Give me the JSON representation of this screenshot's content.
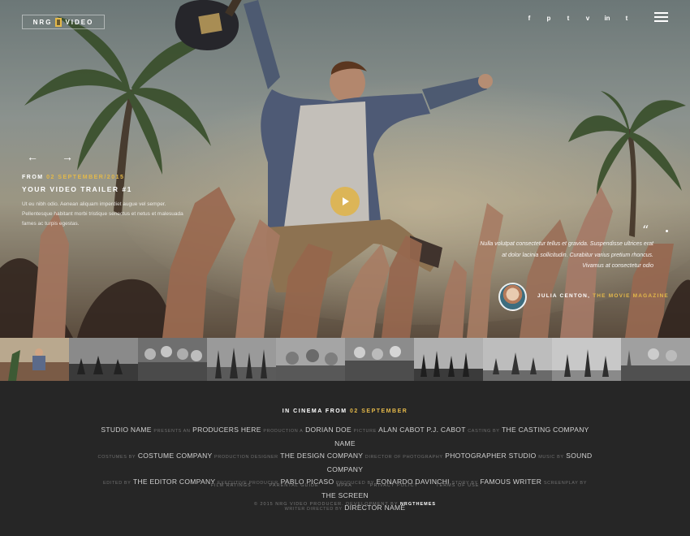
{
  "header": {
    "logo_left": "NRG",
    "logo_right": "VIDEO",
    "social": [
      "f",
      "p",
      "t",
      "v",
      "in",
      "t"
    ]
  },
  "slider": {
    "prev_icon": "arrow-left-icon",
    "next_icon": "arrow-right-icon",
    "from_label": "FROM",
    "from_date": "02 SEPTEMBER/2015",
    "title": "YOUR VIDEO TRAILER #1",
    "description": "Ut eu nibh odio. Aenean aliquam imperdiet augue vel semper. Pellentesque habitant morbi tristique senectus et netus et malesuada fames ac turpis egestas.",
    "quote": "Nulla volutpat consectetur tellus et gravida. Suspendisse ultrices erat at dolor lacinia sollicitudin. Curabitur varius pretium rhoncus. Vivamus at consectetur odio",
    "author_name": "JULIA CENTON,",
    "author_source": "THE MOVIE MAGAZINE"
  },
  "footer": {
    "in_cinema_label": "IN CINEMA FROM",
    "in_cinema_date": "02 SEPTEMBER",
    "credits": {
      "studio_name": "STUDIO NAME",
      "presents_an": "PRESENTS AN",
      "producers_here": "PRODUCERS HERE",
      "production_a": "PRODUCTION A",
      "dorian_doe": "DORIAN DOE",
      "picture": "PICTURE",
      "alan_cabot": "ALAN CABOT P.J. CABOT",
      "casting_by": "CASTING BY",
      "casting_company": "THE CASTING COMPANY NAME",
      "costumes_by": "COSTUMES BY",
      "costume_company": "COSTUME COMPANY",
      "production_designer": "PRODUCTION DESIGNER",
      "design_company": "THE DESIGN COMPANY",
      "director_of_photography": "DIRECTOR OF PHOTOGRAPHY",
      "photographer_studio": "PHOTOGRAPHER STUDIO",
      "music_by": "MUSIC BY",
      "sound_company": "SOUND COMPANY",
      "edited_by": "EDITED BY",
      "editor_company": "THE EDITOR COMPANY",
      "executive_producer": "EXECUTIVE PRODUCER",
      "pablo_picaso": "PABLO PICASO",
      "produced_by": "PRODUCED BY",
      "eonardo_davinchi": "EONARDO DAVINCHI",
      "story_by": "STORY BY",
      "famous_writer": "FAMOUS WRITER",
      "screenplay_by": "SCREENPLAY BY",
      "the_screen": "THE SCREEN",
      "writer_directed_by": "WRITER DIRECTED BY",
      "director_name": "DIRECTOR NAME"
    },
    "links": [
      "FILM RATINGS",
      "PARENTAL GUIDE",
      "MPAA",
      "PRIVACY POLICY",
      "TERMS OF USE"
    ],
    "copyright": "© 2015 NRG VIDEO PRODUCER. DEVELOPMENT BY",
    "copyright_brand": "NRGTHEMES"
  },
  "colors": {
    "accent": "#e4b94a",
    "footer_bg": "#262626"
  }
}
